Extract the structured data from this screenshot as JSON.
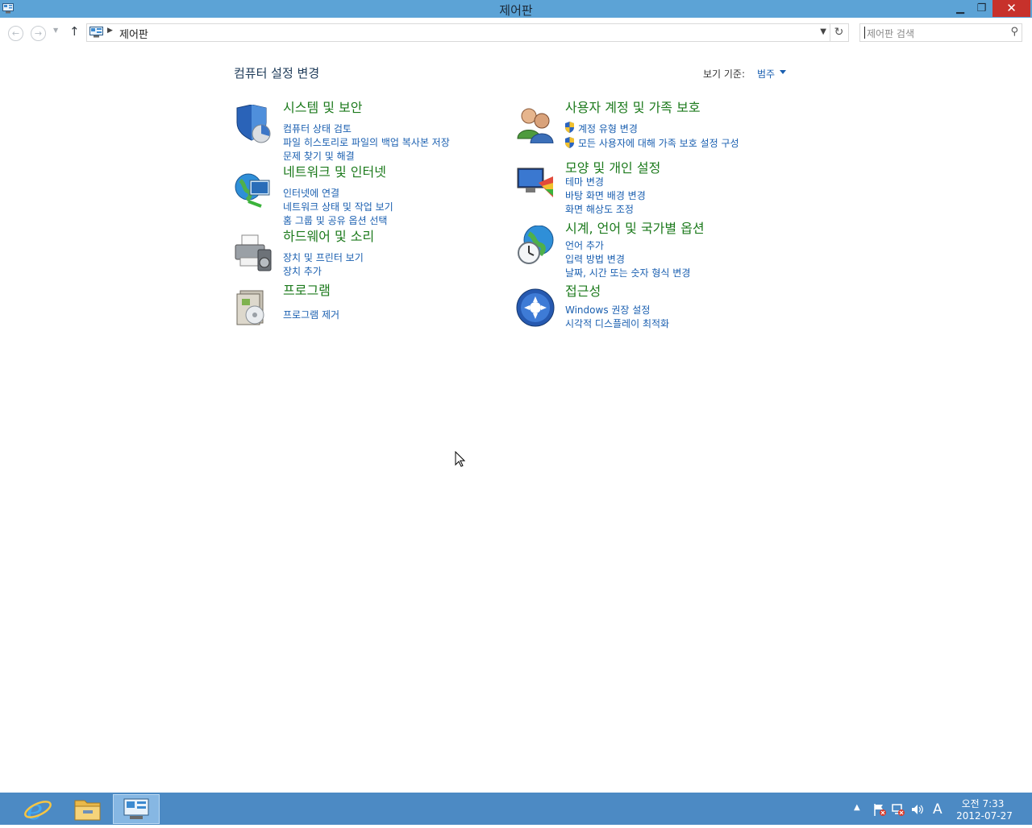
{
  "window": {
    "title": "제어판"
  },
  "address": {
    "crumb": "제어판"
  },
  "search": {
    "placeholder": "제어판 검색"
  },
  "main": {
    "heading": "컴퓨터 설정 변경",
    "view_by_label": "보기 기준:",
    "view_by_value": "범주"
  },
  "categories": [
    {
      "title": "시스템 및 보안",
      "links": [
        "컴퓨터 상태 검토",
        "파일 히스토리로 파일의 백업 복사본 저장",
        "문제 찾기 및 해결"
      ]
    },
    {
      "title": "네트워크 및 인터넷",
      "links": [
        "인터넷에 연결",
        "네트워크 상태 및 작업 보기",
        "홈 그룹 및 공유 옵션 선택"
      ]
    },
    {
      "title": "하드웨어 및 소리",
      "links": [
        "장치 및 프린터 보기",
        "장치 추가"
      ]
    },
    {
      "title": "프로그램",
      "links": [
        "프로그램 제거"
      ]
    },
    {
      "title": "사용자 계정 및 가족 보호",
      "links": [
        "계정 유형 변경",
        "모든 사용자에 대해 가족 보호 설정 구성"
      ]
    },
    {
      "title": "모양 및 개인 설정",
      "links": [
        "테마 변경",
        "바탕 화면 배경 변경",
        "화면 해상도 조정"
      ]
    },
    {
      "title": "시계, 언어 및 국가별 옵션",
      "links": [
        "언어 추가",
        "입력 방법 변경",
        "날짜, 시간 또는 숫자 형식 변경"
      ]
    },
    {
      "title": "접근성",
      "links": [
        "Windows 권장 설정",
        "시각적 디스플레이 최적화"
      ]
    }
  ],
  "taskbar": {
    "ime": "A",
    "time": "오전 7:33",
    "date": "2012-07-27"
  },
  "colors": {
    "title_bar": "#5ca3d6",
    "taskbar": "#4c8ac4",
    "link": "#1a5fb0",
    "category_title": "#1c7a1c",
    "close_button": "#c7312b"
  }
}
